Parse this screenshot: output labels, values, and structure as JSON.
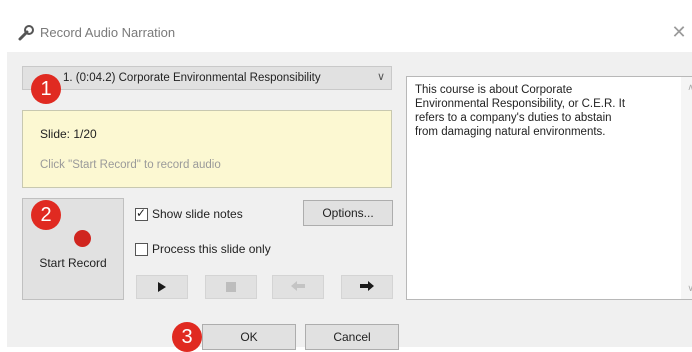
{
  "window": {
    "title": "Record Audio Narration"
  },
  "slide_selector": {
    "value": "1. (0:04.2) Corporate Environmental Responsibility"
  },
  "info": {
    "slide_label": "Slide: 1/20",
    "hint": "Click \"Start Record\" to record audio"
  },
  "record": {
    "label": "Start Record"
  },
  "options": {
    "show_slide_notes": {
      "label": "Show slide notes",
      "checked": true
    },
    "process_slide_only": {
      "label": "Process this slide only",
      "checked": false
    },
    "options_button": "Options..."
  },
  "notes": {
    "text": "This course is about Corporate\nEnvironmental Responsibility, or C.E.R. It\nrefers to a company's duties to abstain\nfrom damaging natural environments."
  },
  "footer": {
    "ok": "OK",
    "cancel": "Cancel"
  },
  "callouts": [
    "1",
    "2",
    "3"
  ],
  "icons": {
    "title": "wrench-icon",
    "close": "close-icon",
    "record": "record-icon",
    "play": "play-icon",
    "stop": "stop-icon",
    "back": "back-arrow-icon",
    "next": "next-arrow-icon"
  },
  "colors": {
    "callout": "#e02a21",
    "record_dot": "#d0251f",
    "info_bg": "#fcf8d2"
  }
}
